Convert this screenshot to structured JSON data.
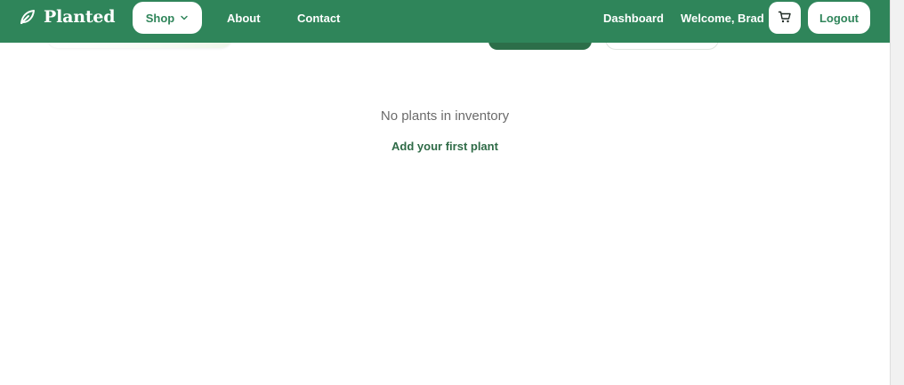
{
  "brand": {
    "name": "Planted",
    "icon": "leaf-icon"
  },
  "nav": {
    "shop_label": "Shop",
    "about_label": "About",
    "contact_label": "Contact",
    "dashboard_label": "Dashboard",
    "welcome_text": "Welcome, Brad",
    "cart_icon": "cart-icon",
    "logout_label": "Logout"
  },
  "inventory": {
    "empty_message": "No plants in inventory",
    "add_first_label": "Add your first plant"
  },
  "colors": {
    "navbar": "#2f855a",
    "primary_dark": "#2c6e49",
    "text_muted": "#6b6b6b",
    "link_green": "#2f6b47",
    "white": "#ffffff"
  }
}
